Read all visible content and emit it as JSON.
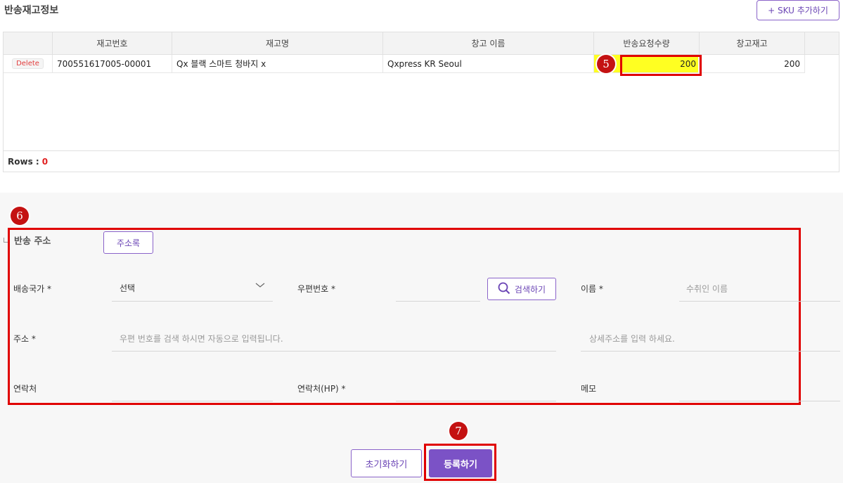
{
  "top": {
    "title": "반송재고정보",
    "add_sku_label": "+ SKU 추가하기"
  },
  "grid": {
    "columns": [
      "재고번호",
      "재고명",
      "창고 이름",
      "반송요청수량",
      "창고재고"
    ],
    "rows": [
      {
        "action": "Delete",
        "stock_no": "700551617005-00001",
        "stock_name": "Qx 블랙 스마트 청바지 x",
        "warehouse": "Qxpress KR Seoul",
        "return_qty": "200",
        "warehouse_stock": "200"
      }
    ],
    "rows_label": "Rows :",
    "rows_count": "0"
  },
  "badges": {
    "b5": "5",
    "b6": "6",
    "b7": "7"
  },
  "address": {
    "title": "반송 주소",
    "book_label": "주소록",
    "country_label": "배송국가 *",
    "country_value": "선택",
    "zip_label": "우편번호 *",
    "search_label": "검색하기",
    "name_label": "이름 *",
    "name_placeholder": "수취인 이름",
    "addr_label": "주소 *",
    "addr_placeholder": "우편 번호를 검색 하시면 자동으로 입력됩니다.",
    "detail_placeholder": "상세주소를 입력 하세요.",
    "phone_label": "연락처",
    "mobile_label": "연락처(HP) *",
    "memo_label": "메모"
  },
  "actions": {
    "reset_label": "초기화하기",
    "submit_label": "등록하기"
  },
  "colors": {
    "accent": "#7b52c6",
    "highlight": "#ffff22",
    "annotation": "#e00000"
  }
}
